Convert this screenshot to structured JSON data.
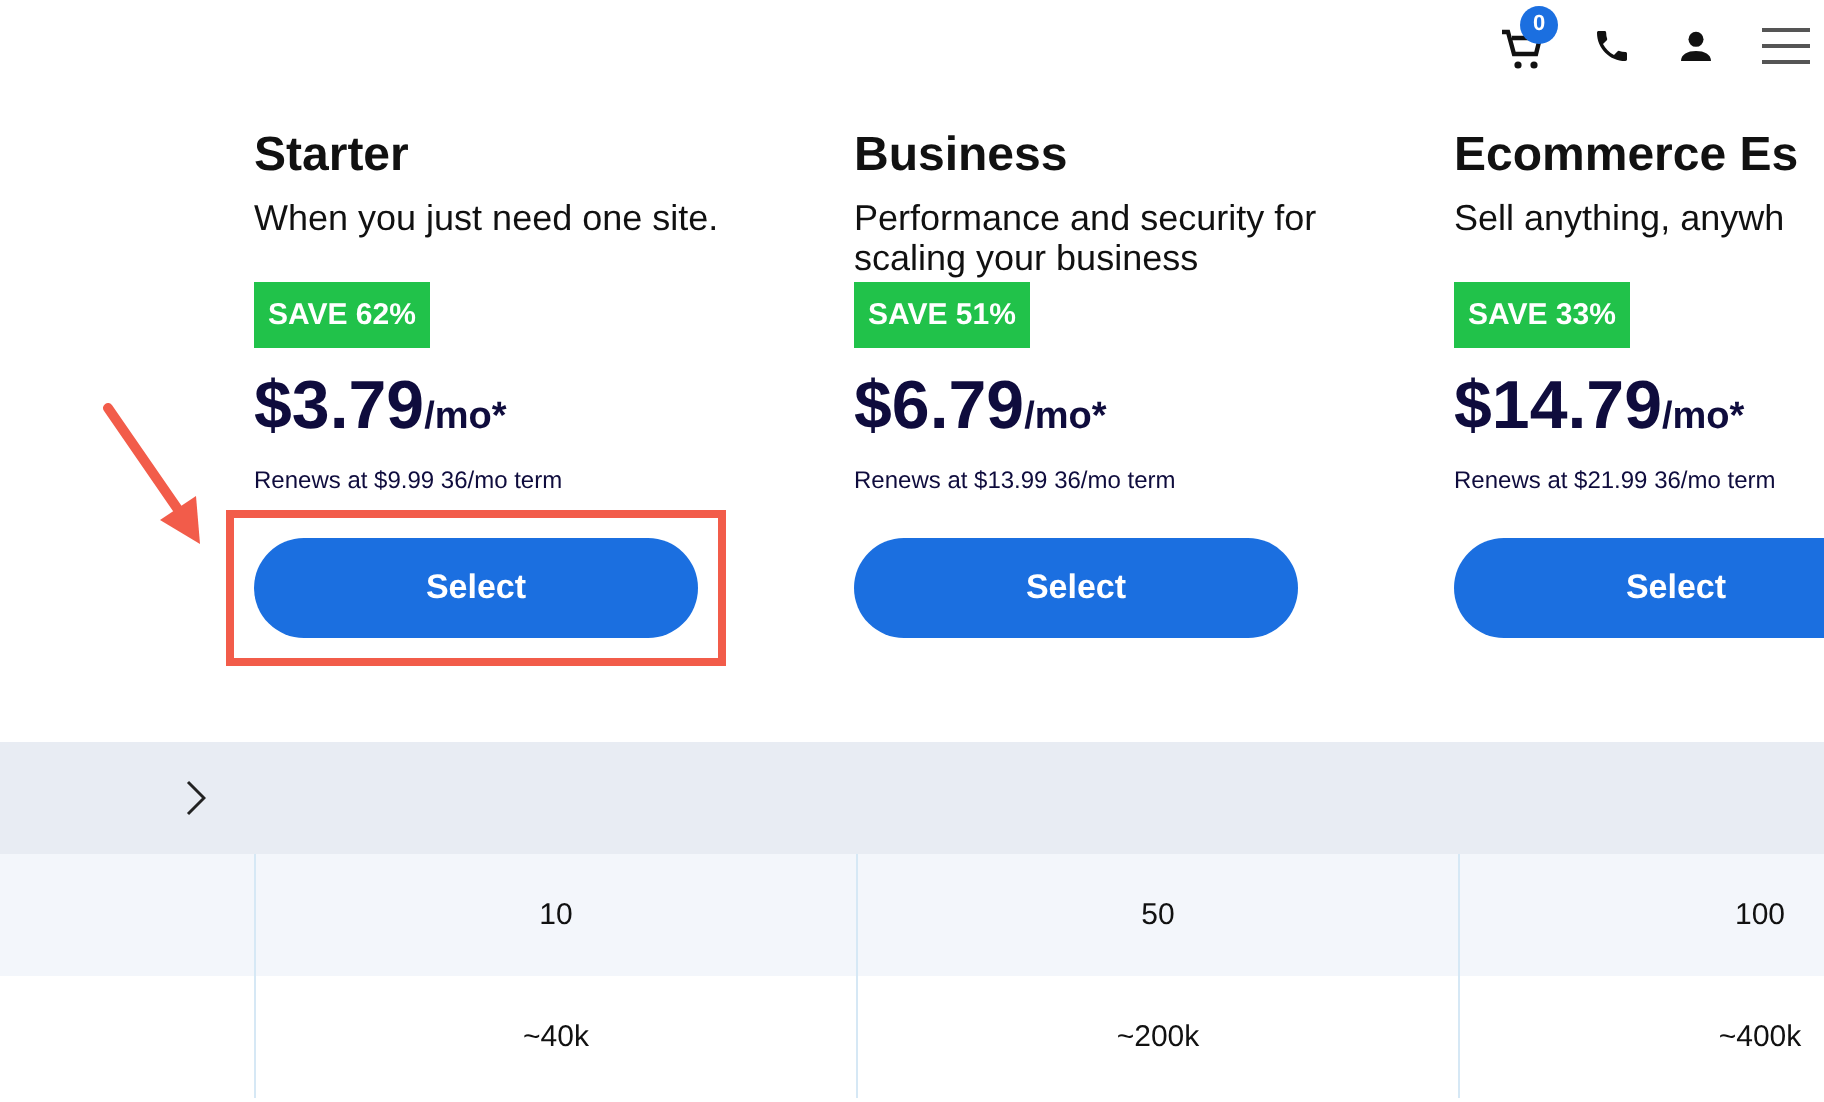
{
  "header": {
    "cart_count": "0"
  },
  "plans": [
    {
      "name": "Starter",
      "tagline": "When you just need one site.",
      "badge": "SAVE 62%",
      "price": "$3.79",
      "unit": "/mo*",
      "renewal": "Renews at $9.99 36/mo term",
      "button": "Select",
      "highlighted": true
    },
    {
      "name": "Business",
      "tagline": "Performance and security for scaling your business",
      "badge": "SAVE 51%",
      "price": "$6.79",
      "unit": "/mo*",
      "renewal": "Renews at $13.99 36/mo term",
      "button": "Select",
      "highlighted": false
    },
    {
      "name": "Ecommerce Es",
      "tagline": "Sell anything, anywh",
      "badge": "SAVE 33%",
      "price": "$14.79",
      "unit": "/mo*",
      "renewal": "Renews at $21.99 36/mo term",
      "button": "Select",
      "highlighted": false
    }
  ],
  "table": {
    "section_expanded": false,
    "rows": [
      [
        "10",
        "50",
        "100"
      ],
      [
        "~40k",
        "~200k",
        "~400k"
      ]
    ]
  }
}
